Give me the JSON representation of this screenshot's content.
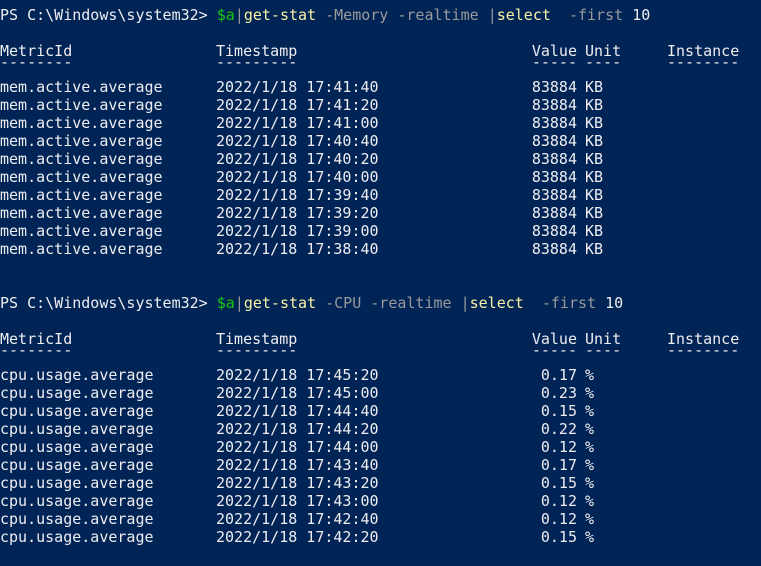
{
  "colors": {
    "background": "#012456",
    "text": "#eeedf0",
    "command": "#f9f1a5",
    "parameter": "#9a9a9a",
    "variable": "#16c60c"
  },
  "blocks": [
    {
      "prompt": "PS C:\\Windows\\system32> ",
      "command": {
        "variable": "$a",
        "pipe1": "|",
        "cmdlet": "get-stat",
        "args": " -Memory -realtime ",
        "pipe2": "|",
        "cmdlet2": "select",
        "param": "  -first ",
        "value": "10"
      },
      "headers": {
        "metric": "MetricId",
        "timestamp": "Timestamp",
        "value": "Value",
        "unit": "Unit",
        "instance": "Instance"
      },
      "separators": {
        "metric": "--------",
        "timestamp": "---------",
        "value": "-----",
        "unit": "----",
        "instance": "--------"
      },
      "rows": [
        {
          "metric": "mem.active.average",
          "timestamp": "2022/1/18 17:41:40",
          "value": "83884",
          "unit": "KB"
        },
        {
          "metric": "mem.active.average",
          "timestamp": "2022/1/18 17:41:20",
          "value": "83884",
          "unit": "KB"
        },
        {
          "metric": "mem.active.average",
          "timestamp": "2022/1/18 17:41:00",
          "value": "83884",
          "unit": "KB"
        },
        {
          "metric": "mem.active.average",
          "timestamp": "2022/1/18 17:40:40",
          "value": "83884",
          "unit": "KB"
        },
        {
          "metric": "mem.active.average",
          "timestamp": "2022/1/18 17:40:20",
          "value": "83884",
          "unit": "KB"
        },
        {
          "metric": "mem.active.average",
          "timestamp": "2022/1/18 17:40:00",
          "value": "83884",
          "unit": "KB"
        },
        {
          "metric": "mem.active.average",
          "timestamp": "2022/1/18 17:39:40",
          "value": "83884",
          "unit": "KB"
        },
        {
          "metric": "mem.active.average",
          "timestamp": "2022/1/18 17:39:20",
          "value": "83884",
          "unit": "KB"
        },
        {
          "metric": "mem.active.average",
          "timestamp": "2022/1/18 17:39:00",
          "value": "83884",
          "unit": "KB"
        },
        {
          "metric": "mem.active.average",
          "timestamp": "2022/1/18 17:38:40",
          "value": "83884",
          "unit": "KB"
        }
      ]
    },
    {
      "prompt": "PS C:\\Windows\\system32> ",
      "command": {
        "variable": "$a",
        "pipe1": "|",
        "cmdlet": "get-stat",
        "args": " -CPU -realtime ",
        "pipe2": "|",
        "cmdlet2": "select",
        "param": "  -first ",
        "value": "10"
      },
      "headers": {
        "metric": "MetricId",
        "timestamp": "Timestamp",
        "value": "Value",
        "unit": "Unit",
        "instance": "Instance"
      },
      "separators": {
        "metric": "--------",
        "timestamp": "---------",
        "value": "-----",
        "unit": "----",
        "instance": "--------"
      },
      "rows": [
        {
          "metric": "cpu.usage.average",
          "timestamp": "2022/1/18 17:45:20",
          "value": "0.17",
          "unit": "%"
        },
        {
          "metric": "cpu.usage.average",
          "timestamp": "2022/1/18 17:45:00",
          "value": "0.23",
          "unit": "%"
        },
        {
          "metric": "cpu.usage.average",
          "timestamp": "2022/1/18 17:44:40",
          "value": "0.15",
          "unit": "%"
        },
        {
          "metric": "cpu.usage.average",
          "timestamp": "2022/1/18 17:44:20",
          "value": "0.22",
          "unit": "%"
        },
        {
          "metric": "cpu.usage.average",
          "timestamp": "2022/1/18 17:44:00",
          "value": "0.12",
          "unit": "%"
        },
        {
          "metric": "cpu.usage.average",
          "timestamp": "2022/1/18 17:43:40",
          "value": "0.17",
          "unit": "%"
        },
        {
          "metric": "cpu.usage.average",
          "timestamp": "2022/1/18 17:43:20",
          "value": "0.15",
          "unit": "%"
        },
        {
          "metric": "cpu.usage.average",
          "timestamp": "2022/1/18 17:43:00",
          "value": "0.12",
          "unit": "%"
        },
        {
          "metric": "cpu.usage.average",
          "timestamp": "2022/1/18 17:42:40",
          "value": "0.12",
          "unit": "%"
        },
        {
          "metric": "cpu.usage.average",
          "timestamp": "2022/1/18 17:42:20",
          "value": "0.15",
          "unit": "%"
        }
      ]
    }
  ]
}
